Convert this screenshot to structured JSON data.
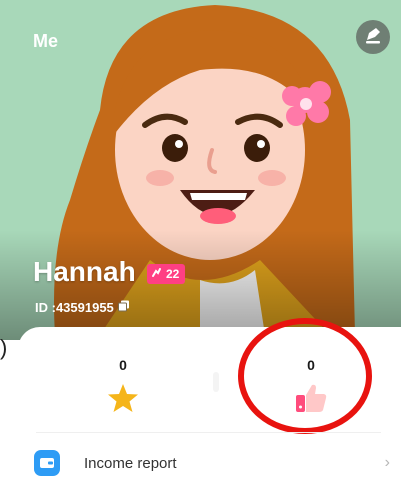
{
  "header": {
    "title": "Me"
  },
  "profile": {
    "name": "Hannah",
    "level": "22",
    "id_text": "ID :43591955"
  },
  "stats": [
    {
      "value": "0",
      "icon": "star-icon"
    },
    {
      "value": "0",
      "icon": "thumbs-up-icon"
    }
  ],
  "annotation": {
    "left_paren": ")"
  },
  "menu": {
    "income_report": "Income report"
  },
  "colors": {
    "hero_bg": "#a8d8b9",
    "badge": "#ff3f83",
    "highlight": "#e8130f",
    "menu_icon": "#2e9cf5"
  }
}
